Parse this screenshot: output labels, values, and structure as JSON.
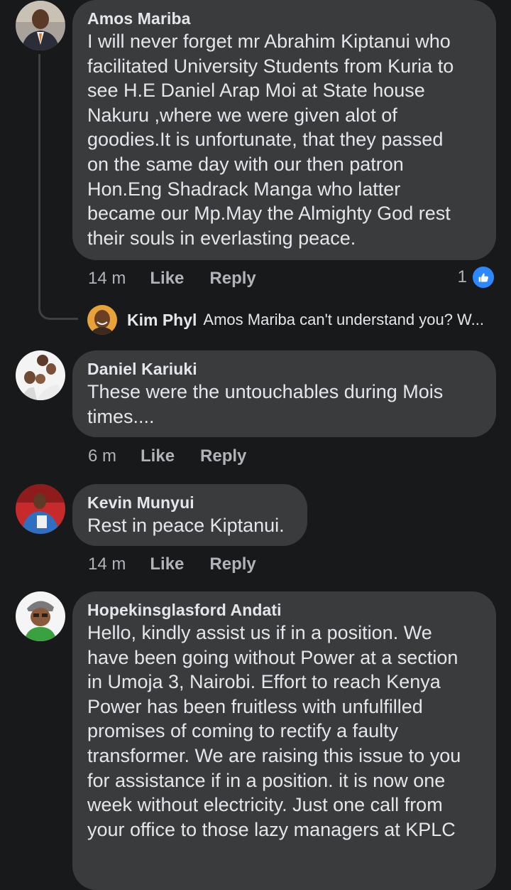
{
  "comments": [
    {
      "author": "Amos Mariba",
      "text": "I will never forget mr Abrahim Kiptanui who\nfacilitated University Students from Kuria to\nsee H.E Daniel Arap Moi at State house\nNakuru ,where we were given alot of\ngoodies.It  is  unfortunate, that they passed\non the same day with our then patron\nHon.Eng Shadrack Manga who latter\nbecame our Mp.May the Almighty God rest\ntheir souls in everlasting peace.",
      "time": "14 m",
      "like_label": "Like",
      "reply_label": "Reply",
      "reaction_count": "1",
      "reply_preview": {
        "author": "Kim Phyl",
        "text": "Amos Mariba can't understand you? W..."
      }
    },
    {
      "author": "Daniel Kariuki",
      "text": "These were the untouchables during Mois\ntimes....",
      "time": "6 m",
      "like_label": "Like",
      "reply_label": "Reply"
    },
    {
      "author": "Kevin Munyui",
      "text": "Rest in peace Kiptanui.",
      "time": "14 m",
      "like_label": "Like",
      "reply_label": "Reply"
    },
    {
      "author": "Hopekinsglasford Andati",
      "text": "Hello, kindly assist us if in a position. We\nhave been going without Power at a section\nin Umoja 3, Nairobi. Effort to reach Kenya\nPower has been fruitless with unfulfilled\npromises of coming to rectify a faulty\ntransformer. We are raising this issue to you\nfor assistance if in a position. it is now one\nweek without electricity.  Just one call from\nyour office to those lazy managers at KPLC"
    }
  ],
  "colors": {
    "background": "#18191a",
    "bubble": "#3a3b3c",
    "text": "#e4e6eb",
    "secondary_text": "#b0b3b8",
    "like_badge": "#2d88ff"
  },
  "icons": {
    "reaction": "thumbs-up-icon"
  }
}
